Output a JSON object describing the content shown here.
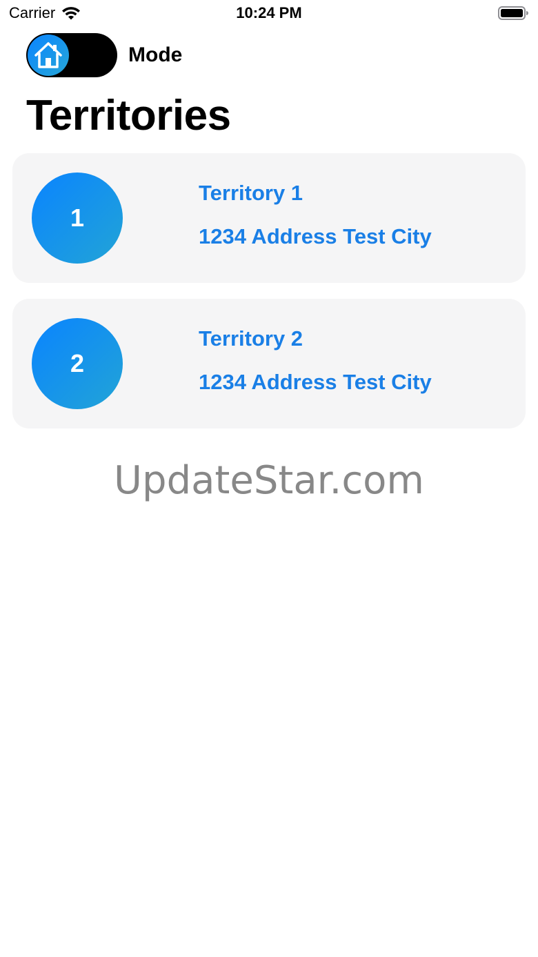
{
  "status_bar": {
    "carrier": "Carrier",
    "time": "10:24 PM"
  },
  "mode": {
    "label": "Mode",
    "toggle_icon": "house-icon"
  },
  "page_title": "Territories",
  "territories": [
    {
      "number": "1",
      "name": "Territory 1",
      "address": "1234 Address Test City"
    },
    {
      "number": "2",
      "name": "Territory 2",
      "address": "1234 Address Test City"
    }
  ],
  "watermark": "UpdateStar.com",
  "colors": {
    "accent": "#1a7fe6",
    "badge_start": "#0a84ff",
    "badge_end": "#22a4d6",
    "card_bg": "#f5f5f6",
    "toggle_track": "#000000"
  }
}
